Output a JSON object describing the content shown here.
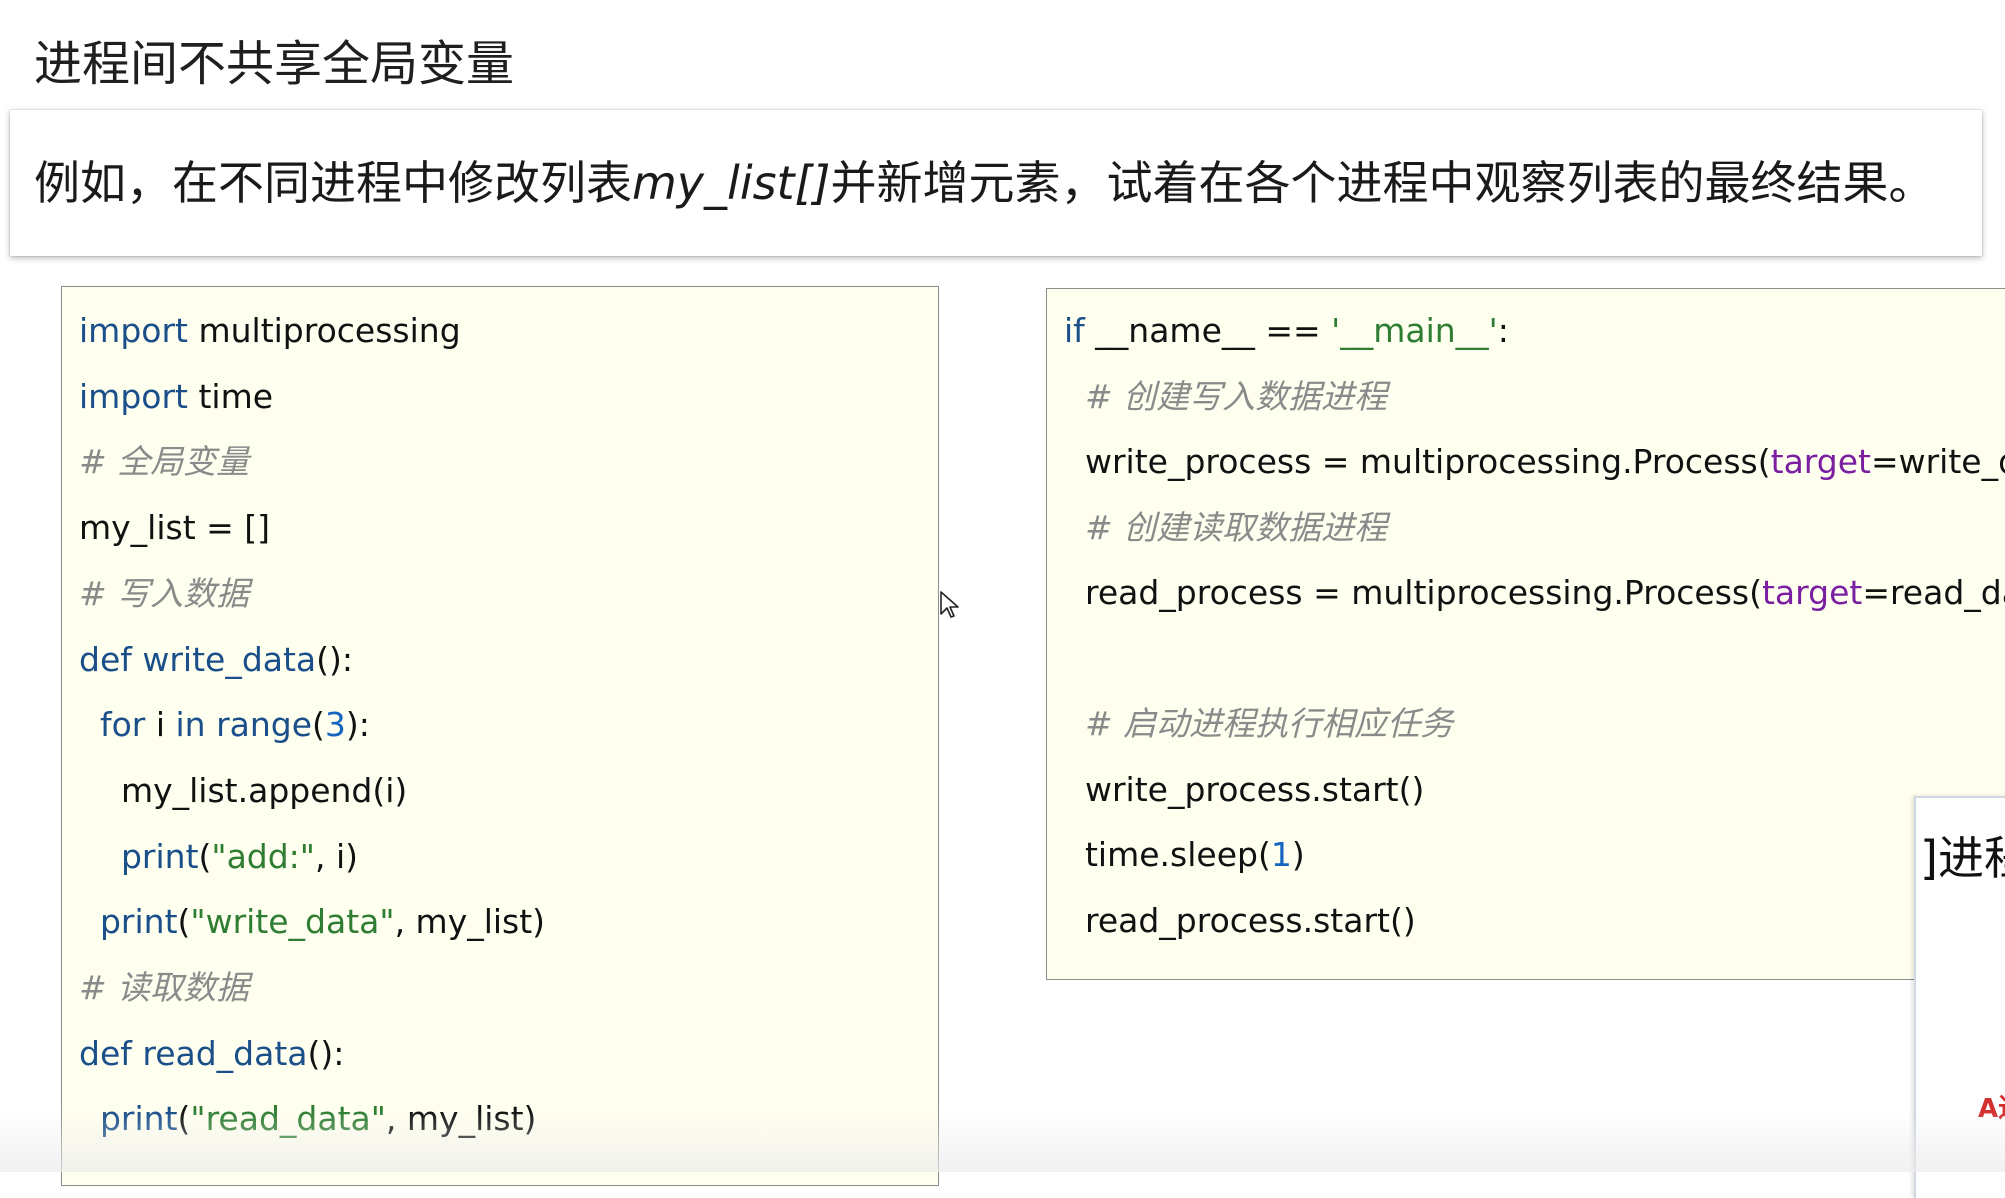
{
  "slide": {
    "title": "进程间不共享全局变量",
    "description": {
      "before": "例如，在不同进程中修改列表",
      "emphasis": "my_list[]",
      "after": "并新增元素，试着在各个进程中观察列表的最终结果。"
    }
  },
  "left_code": [
    [
      {
        "t": "kw",
        "v": "import"
      },
      {
        "t": "plain",
        "v": " multiprocessing"
      }
    ],
    [
      {
        "t": "kw",
        "v": "import"
      },
      {
        "t": "plain",
        "v": " time"
      }
    ],
    [
      {
        "t": "cm",
        "v": "# 全局变量"
      }
    ],
    [
      {
        "t": "plain",
        "v": "my_list = []"
      }
    ],
    [
      {
        "t": "cm",
        "v": "# 写入数据"
      }
    ],
    [
      {
        "t": "kw",
        "v": "def write_data"
      },
      {
        "t": "plain",
        "v": "():"
      }
    ],
    [
      {
        "t": "plain",
        "v": "  "
      },
      {
        "t": "kw",
        "v": "for"
      },
      {
        "t": "plain",
        "v": " i "
      },
      {
        "t": "kw",
        "v": "in range"
      },
      {
        "t": "plain",
        "v": "("
      },
      {
        "t": "num",
        "v": "3"
      },
      {
        "t": "plain",
        "v": "):"
      }
    ],
    [
      {
        "t": "plain",
        "v": "    my_list.append(i)"
      }
    ],
    [
      {
        "t": "plain",
        "v": "    "
      },
      {
        "t": "kw",
        "v": "print"
      },
      {
        "t": "plain",
        "v": "("
      },
      {
        "t": "str",
        "v": "\"add:\""
      },
      {
        "t": "plain",
        "v": ", i)"
      }
    ],
    [
      {
        "t": "plain",
        "v": "  "
      },
      {
        "t": "kw",
        "v": "print"
      },
      {
        "t": "plain",
        "v": "("
      },
      {
        "t": "str",
        "v": "\"write_data\""
      },
      {
        "t": "plain",
        "v": ", my_list)"
      }
    ],
    [
      {
        "t": "cm",
        "v": "# 读取数据"
      }
    ],
    [
      {
        "t": "kw",
        "v": "def read_data"
      },
      {
        "t": "plain",
        "v": "():"
      }
    ],
    [
      {
        "t": "plain",
        "v": "  "
      },
      {
        "t": "kw",
        "v": "print"
      },
      {
        "t": "plain",
        "v": "("
      },
      {
        "t": "str",
        "v": "\"read_data\""
      },
      {
        "t": "plain",
        "v": ", my_list)"
      }
    ]
  ],
  "right_code": [
    [
      {
        "t": "kw",
        "v": "if"
      },
      {
        "t": "plain",
        "v": " __name__ == "
      },
      {
        "t": "str",
        "v": "'__main__'"
      },
      {
        "t": "plain",
        "v": ":"
      }
    ],
    [
      {
        "t": "plain",
        "v": "  "
      },
      {
        "t": "cm",
        "v": "# 创建写入数据进程"
      }
    ],
    [
      {
        "t": "plain",
        "v": "  write_process = multiprocessing.Process("
      },
      {
        "t": "arg",
        "v": "target"
      },
      {
        "t": "plain",
        "v": "=write_data)"
      }
    ],
    [
      {
        "t": "plain",
        "v": "  "
      },
      {
        "t": "cm",
        "v": "# 创建读取数据进程"
      }
    ],
    [
      {
        "t": "plain",
        "v": "  read_process = multiprocessing.Process("
      },
      {
        "t": "arg",
        "v": "target"
      },
      {
        "t": "plain",
        "v": "=read_data)"
      }
    ],
    [
      {
        "t": "plain",
        "v": ""
      }
    ],
    [
      {
        "t": "plain",
        "v": "  "
      },
      {
        "t": "cm",
        "v": "# 启动进程执行相应任务"
      }
    ],
    [
      {
        "t": "plain",
        "v": "  write_process.start()"
      }
    ],
    [
      {
        "t": "plain",
        "v": "  time.sleep("
      },
      {
        "t": "num",
        "v": "1"
      },
      {
        "t": "plain",
        "v": ")"
      }
    ],
    [
      {
        "t": "plain",
        "v": "  read_process.start()"
      }
    ]
  ],
  "overlay": {
    "partial_text": "]进程",
    "red_label": "A进"
  },
  "colors": {
    "keyword": "#1a4f8a",
    "string": "#2e7d32",
    "number": "#1565c0",
    "argument": "#7b1fa2",
    "comment": "#8a8a8a",
    "panel_bg": "#fffff0"
  }
}
